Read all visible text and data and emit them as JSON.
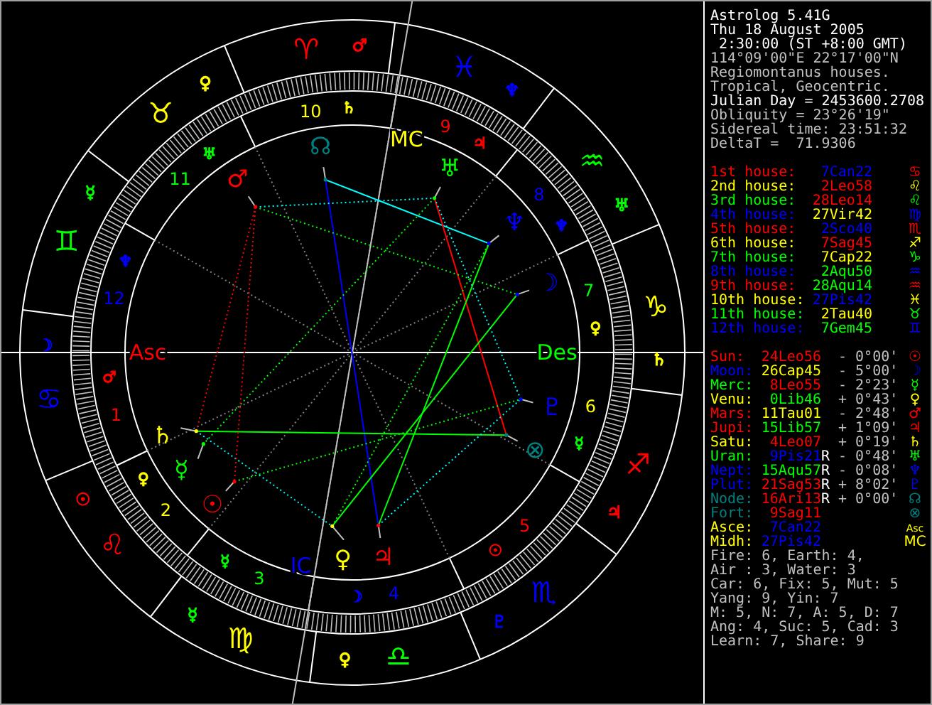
{
  "chart": {
    "signs": [
      {
        "glyph": "♈",
        "color": "#ff0000",
        "ruler": {
          "glyph": "♂",
          "color": "#ff0000"
        }
      },
      {
        "glyph": "♉",
        "color": "#ffff00",
        "ruler": {
          "glyph": "♀",
          "color": "#ffff00"
        }
      },
      {
        "glyph": "♊",
        "color": "#00ff00",
        "ruler": {
          "glyph": "☿",
          "color": "#00ff00"
        }
      },
      {
        "glyph": "♋",
        "color": "#0000ff",
        "ruler": {
          "glyph": "☽",
          "color": "#0000ff"
        }
      },
      {
        "glyph": "♌",
        "color": "#ff0000",
        "ruler": {
          "glyph": "☉",
          "color": "#ff0000"
        }
      },
      {
        "glyph": "♍",
        "color": "#ffff00",
        "ruler": {
          "glyph": "☿",
          "color": "#00ff00"
        }
      },
      {
        "glyph": "♎",
        "color": "#00ff00",
        "ruler": {
          "glyph": "♀",
          "color": "#ffff00"
        }
      },
      {
        "glyph": "♏",
        "color": "#0000ff",
        "ruler": {
          "glyph": "♇",
          "color": "#0000ff"
        }
      },
      {
        "glyph": "♐",
        "color": "#ff0000",
        "ruler": {
          "glyph": "♃",
          "color": "#ff0000"
        }
      },
      {
        "glyph": "♑",
        "color": "#ffff00",
        "ruler": {
          "glyph": "♄",
          "color": "#ffff00"
        }
      },
      {
        "glyph": "♒",
        "color": "#00ff00",
        "ruler": {
          "glyph": "♅",
          "color": "#00ff00"
        }
      },
      {
        "glyph": "♓",
        "color": "#0000ff",
        "ruler": {
          "glyph": "♆",
          "color": "#0000ff"
        }
      }
    ],
    "houses": [
      {
        "number": "1",
        "color": "#ff0000",
        "ruler": {
          "glyph": "♂",
          "color": "#ff0000"
        }
      },
      {
        "number": "2",
        "color": "#ffff00",
        "ruler": {
          "glyph": "♀",
          "color": "#ffff00"
        }
      },
      {
        "number": "3",
        "color": "#00ff00",
        "ruler": {
          "glyph": "☿",
          "color": "#00ff00"
        }
      },
      {
        "number": "4",
        "color": "#0000ff",
        "ruler": {
          "glyph": "☽",
          "color": "#0000ff"
        }
      },
      {
        "number": "5",
        "color": "#ff0000",
        "ruler": {
          "glyph": "☉",
          "color": "#ff0000"
        }
      },
      {
        "number": "6",
        "color": "#ffff00",
        "ruler": {
          "glyph": "☿",
          "color": "#00ff00"
        }
      },
      {
        "number": "7",
        "color": "#00ff00",
        "ruler": {
          "glyph": "♀",
          "color": "#ffff00"
        }
      },
      {
        "number": "8",
        "color": "#0000ff",
        "ruler": {
          "glyph": "♆",
          "color": "#0000ff"
        }
      },
      {
        "number": "9",
        "color": "#ff0000",
        "ruler": {
          "glyph": "♃",
          "color": "#ff0000"
        }
      },
      {
        "number": "10",
        "color": "#ffff00",
        "ruler": {
          "glyph": "♄",
          "color": "#ffff00"
        }
      },
      {
        "number": "11",
        "color": "#00ff00",
        "ruler": {
          "glyph": "♅",
          "color": "#00ff00"
        }
      },
      {
        "number": "12",
        "color": "#0000ff",
        "ruler": {
          "glyph": "♆",
          "color": "#0000ff"
        }
      }
    ],
    "axes": [
      {
        "label": "Asc",
        "color": "#ff0000"
      },
      {
        "label": "MC",
        "color": "#ffff00"
      },
      {
        "label": "Des",
        "color": "#00ff00"
      },
      {
        "label": "IC",
        "color": "#0000ff"
      }
    ],
    "planets": [
      {
        "glyph": "☉",
        "color": "#ff0000"
      },
      {
        "glyph": "☽",
        "color": "#0000ff"
      },
      {
        "glyph": "☿",
        "color": "#00ff00"
      },
      {
        "glyph": "♀",
        "color": "#ffff00"
      },
      {
        "glyph": "♂",
        "color": "#ff0000"
      },
      {
        "glyph": "♃",
        "color": "#ff0000"
      },
      {
        "glyph": "♄",
        "color": "#ffff00"
      },
      {
        "glyph": "♅",
        "color": "#00ff00"
      },
      {
        "glyph": "♆",
        "color": "#0000ff"
      },
      {
        "glyph": "♇",
        "color": "#0000ff"
      },
      {
        "glyph": "☊",
        "color": "#008080"
      },
      {
        "glyph": "⊗",
        "color": "#008080"
      }
    ]
  },
  "info": {
    "header": [
      {
        "text": "Astrolog 5.41G",
        "bright": true
      },
      {
        "text": "Thu 18 August 2005",
        "bright": true
      },
      {
        "text": " 2:30:00 (ST +8:00 GMT)",
        "bright": true
      },
      {
        "text": "114°09'00\"E 22°17'00\"N",
        "bright": false
      },
      {
        "text": "Regiomontanus houses.",
        "bright": false
      },
      {
        "text": "Tropical, Geocentric.",
        "bright": false
      },
      {
        "text": "Julian Day = 2453600.2708",
        "bright": true
      },
      {
        "text": "Obliquity = 23°26'19\"",
        "bright": false
      },
      {
        "text": "Sidereal time: 23:51:32",
        "bright": false
      },
      {
        "text": "DeltaT =  71.9306",
        "bright": false
      }
    ],
    "houses": [
      {
        "label": "1st house:",
        "color": "#ff0000",
        "position": {
          "text": "7Can22",
          "color": "#0000ff"
        },
        "glyph": "♋"
      },
      {
        "label": "2nd house:",
        "color": "#ffff00",
        "position": {
          "text": "2Leo58",
          "color": "#ff0000"
        },
        "glyph": "♌"
      },
      {
        "label": "3rd house:",
        "color": "#00ff00",
        "position": {
          "text": "28Leo14",
          "color": "#ff0000"
        },
        "glyph": "♌"
      },
      {
        "label": "4th house:",
        "color": "#0000ff",
        "position": {
          "text": "27Vir42",
          "color": "#ffff00"
        },
        "glyph": "♍"
      },
      {
        "label": "5th house:",
        "color": "#ff0000",
        "position": {
          "text": "2Sco40",
          "color": "#0000ff"
        },
        "glyph": "♏"
      },
      {
        "label": "6th house:",
        "color": "#ffff00",
        "position": {
          "text": "7Sag45",
          "color": "#ff0000"
        },
        "glyph": "♐"
      },
      {
        "label": "7th house:",
        "color": "#00ff00",
        "position": {
          "text": "7Cap22",
          "color": "#ffff00"
        },
        "glyph": "♑"
      },
      {
        "label": "8th house:",
        "color": "#0000ff",
        "position": {
          "text": "2Aqu50",
          "color": "#00ff00"
        },
        "glyph": "♒"
      },
      {
        "label": "9th house:",
        "color": "#ff0000",
        "position": {
          "text": "28Aqu14",
          "color": "#00ff00"
        },
        "glyph": "♒"
      },
      {
        "label": "10th house:",
        "color": "#ffff00",
        "position": {
          "text": "27Pis42",
          "color": "#0000ff"
        },
        "glyph": "♓"
      },
      {
        "label": "11th house:",
        "color": "#00ff00",
        "position": {
          "text": "2Tau40",
          "color": "#ffff00"
        },
        "glyph": "♉"
      },
      {
        "label": "12th house:",
        "color": "#0000ff",
        "position": {
          "text": "7Gem45",
          "color": "#00ff00"
        },
        "glyph": "♊"
      }
    ],
    "planets": [
      {
        "name": "Sun:",
        "color": "#ff0000",
        "position": {
          "text": "24Leo56",
          "color": "#ff0000"
        },
        "aspect": "- 0°00'",
        "glyph": "☉"
      },
      {
        "name": "Moon:",
        "color": "#0000ff",
        "position": {
          "text": "26Cap45",
          "color": "#ffff00"
        },
        "aspect": "- 5°00'",
        "glyph": "☽"
      },
      {
        "name": "Merc:",
        "color": "#00ff00",
        "position": {
          "text": "8Leo55",
          "color": "#ff0000"
        },
        "aspect": "- 2°23'",
        "glyph": "☿"
      },
      {
        "name": "Venu:",
        "color": "#ffff00",
        "position": {
          "text": "0Lib46",
          "color": "#00ff00"
        },
        "aspect": "+ 0°43'",
        "glyph": "♀"
      },
      {
        "name": "Mars:",
        "color": "#ff0000",
        "position": {
          "text": "11Tau01",
          "color": "#ffff00"
        },
        "aspect": "- 2°48'",
        "glyph": "♂"
      },
      {
        "name": "Jupi:",
        "color": "#ff0000",
        "position": {
          "text": "15Lib57",
          "color": "#00ff00"
        },
        "aspect": "+ 1°09'",
        "glyph": "♃"
      },
      {
        "name": "Satu:",
        "color": "#ffff00",
        "position": {
          "text": "4Leo07",
          "color": "#ff0000"
        },
        "aspect": "+ 0°19'",
        "glyph": "♄"
      },
      {
        "name": "Uran:",
        "color": "#00ff00",
        "position": {
          "text": "9Pis21",
          "color": "#0000ff"
        },
        "retro": "R",
        "aspect": "- 0°48'",
        "glyph": "♅"
      },
      {
        "name": "Nept:",
        "color": "#0000ff",
        "position": {
          "text": "15Aqu57",
          "color": "#00ff00"
        },
        "retro": "R",
        "aspect": "- 0°08'",
        "glyph": "♆"
      },
      {
        "name": "Plut:",
        "color": "#0000ff",
        "position": {
          "text": "21Sag53",
          "color": "#ff0000"
        },
        "retro": "R",
        "aspect": "+ 8°02'",
        "glyph": "♇"
      },
      {
        "name": "Node:",
        "color": "#008080",
        "position": {
          "text": "16Ari13",
          "color": "#ff0000"
        },
        "retro": "R",
        "aspect": "+ 0°00'",
        "glyph": "☊"
      },
      {
        "name": "Fort:",
        "color": "#008080",
        "position": {
          "text": "9Sag11",
          "color": "#ff0000"
        },
        "glyph": "⊗"
      },
      {
        "name": "Asce:",
        "color": "#ffff00",
        "position": {
          "text": "7Can22",
          "color": "#0000ff"
        },
        "glyph": "Asc"
      },
      {
        "name": "Midh:",
        "color": "#ffff00",
        "position": {
          "text": "27Pis42",
          "color": "#0000ff"
        },
        "glyph": "MC"
      }
    ],
    "stats": [
      "Fire: 6, Earth: 4,",
      "Air : 3, Water: 3",
      "Car: 6, Fix: 5, Mut: 5",
      "Yang: 9, Yin: 7",
      "M: 5, N: 7, A: 5, D: 7",
      "Ang: 4, Suc: 5, Cad: 3",
      "Learn: 7, Share: 9"
    ]
  }
}
